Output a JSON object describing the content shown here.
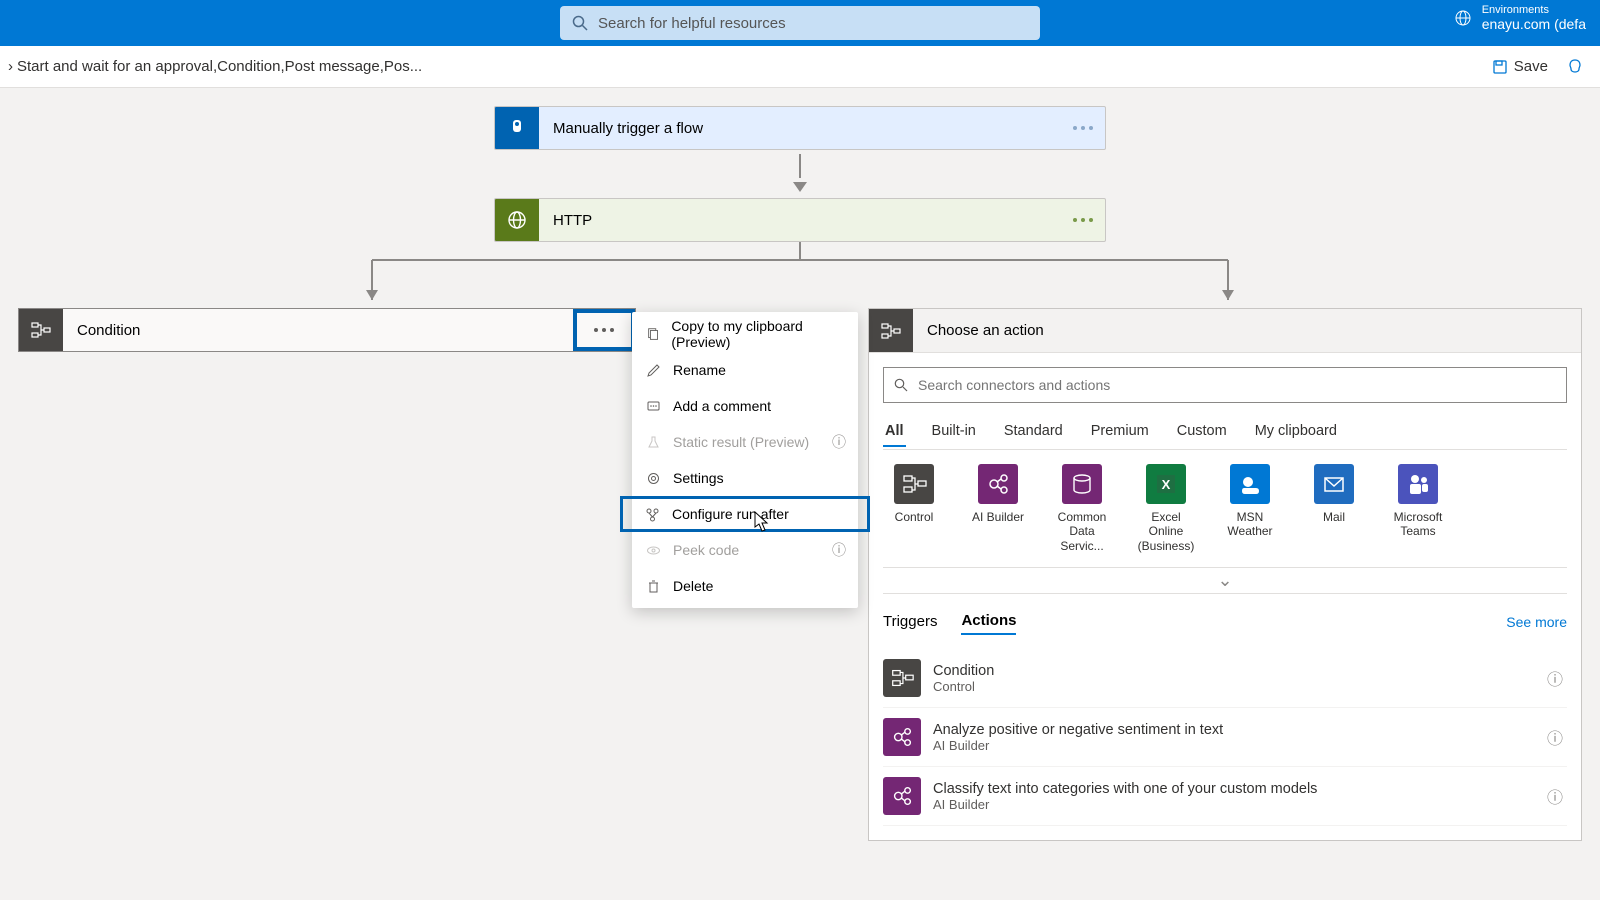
{
  "header": {
    "search_placeholder": "Search for helpful resources",
    "env_label": "Environments",
    "env_value": "enayu.com (defa"
  },
  "breadcrumb": "Start and wait for an approval,Condition,Post message,Pos...",
  "toolbar": {
    "save": "Save"
  },
  "flow": {
    "trigger": "Manually trigger a flow",
    "http": "HTTP",
    "condition": "Condition"
  },
  "ctx_menu": {
    "copy": "Copy to my clipboard (Preview)",
    "rename": "Rename",
    "comment": "Add a comment",
    "static": "Static result (Preview)",
    "settings": "Settings",
    "configure": "Configure run after",
    "peek": "Peek code",
    "delete": "Delete"
  },
  "panel": {
    "title": "Choose an action",
    "search_placeholder": "Search connectors and actions",
    "tabs": [
      "All",
      "Built-in",
      "Standard",
      "Premium",
      "Custom",
      "My clipboard"
    ],
    "connectors": [
      {
        "name": "Control",
        "color": "#484644",
        "ic": "control"
      },
      {
        "name": "AI Builder",
        "color": "#742774",
        "ic": "ai"
      },
      {
        "name": "Common Data Servic...",
        "color": "#742774",
        "ic": "cds"
      },
      {
        "name": "Excel Online (Business)",
        "color": "#107c41",
        "ic": "excel"
      },
      {
        "name": "MSN Weather",
        "color": "#0078d4",
        "ic": "weather"
      },
      {
        "name": "Mail",
        "color": "#1f6cbf",
        "ic": "mail"
      },
      {
        "name": "Microsoft Teams",
        "color": "#4b53bc",
        "ic": "teams"
      }
    ],
    "subtabs": {
      "triggers": "Triggers",
      "actions": "Actions",
      "seemore": "See more"
    },
    "action_list": [
      {
        "title": "Condition",
        "sub": "Control",
        "color": "#484644",
        "ic": "control"
      },
      {
        "title": "Analyze positive or negative sentiment in text",
        "sub": "AI Builder",
        "color": "#742774",
        "ic": "ai"
      },
      {
        "title": "Classify text into categories with one of your custom models",
        "sub": "AI Builder",
        "color": "#742774",
        "ic": "ai"
      }
    ]
  }
}
